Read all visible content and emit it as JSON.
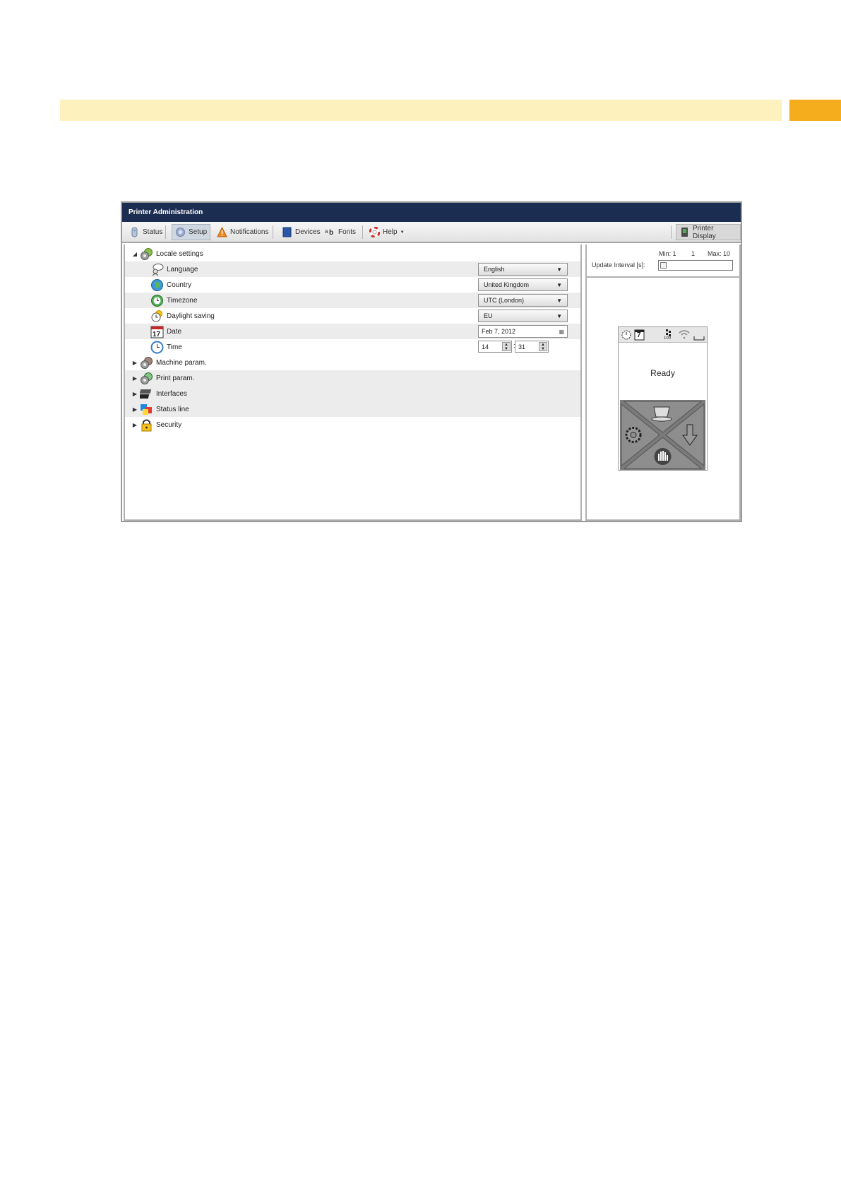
{
  "window": {
    "title": "Printer Administration"
  },
  "toolbar": {
    "status": "Status",
    "setup": "Setup",
    "notifications": "Notifications",
    "devices": "Devices",
    "fonts": "Fonts",
    "help": "Help",
    "printer_display": "Printer Display"
  },
  "tree": {
    "locale": "Locale settings",
    "language": "Language",
    "country": "Country",
    "timezone": "Timezone",
    "daylight": "Daylight saving",
    "date": "Date",
    "time": "Time",
    "machine": "Machine param.",
    "print": "Print param.",
    "interfaces": "Interfaces",
    "statusline": "Status line",
    "security": "Security"
  },
  "values": {
    "language": "English",
    "country": "United Kingdom",
    "timezone": "UTC (London)",
    "daylight": "EU",
    "date": "Feb 7, 2012",
    "hour": "14",
    "minute": "31"
  },
  "interval": {
    "min": "Min: 1",
    "current": "1",
    "max": "Max: 10",
    "label": "Update Interval [s]:",
    "level": 0
  },
  "display": {
    "ready": "Ready",
    "date_day": "7",
    "signal_value": "100"
  },
  "colors": {
    "title_bar": "#1c2d52",
    "header_band": "#fdf1bd",
    "header_tab": "#f5ad1d"
  }
}
